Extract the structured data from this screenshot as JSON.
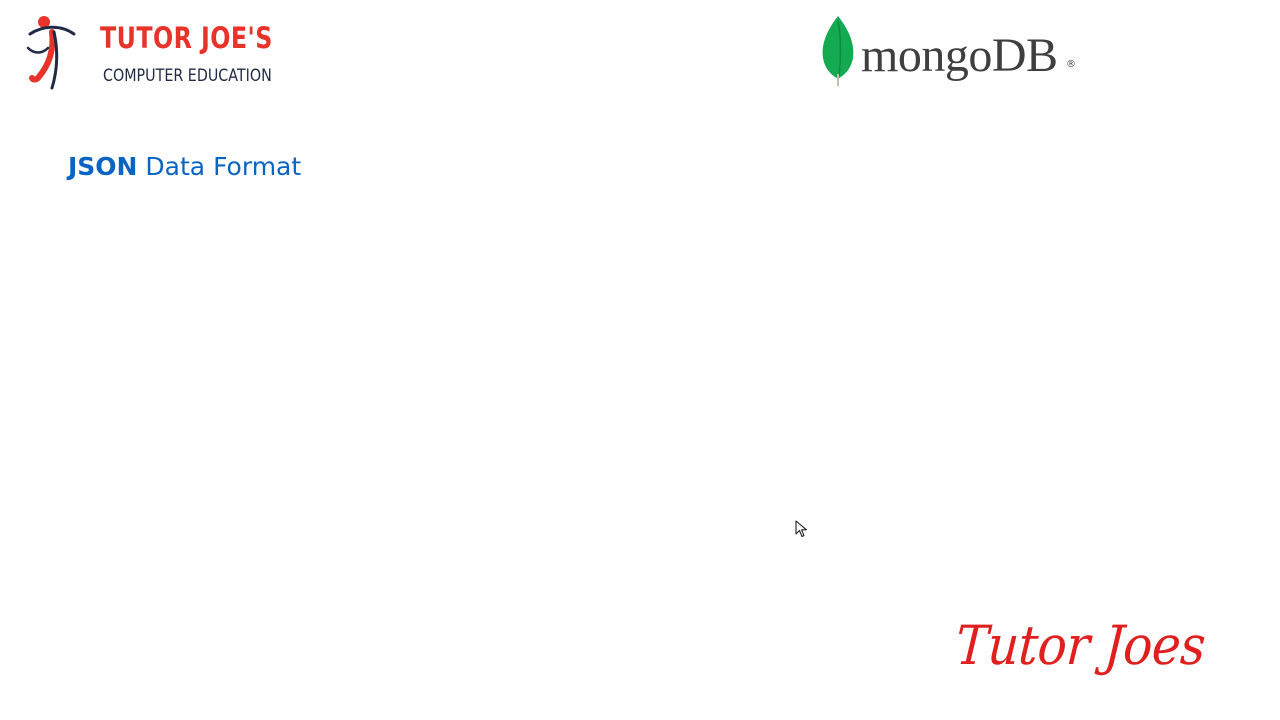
{
  "brand": {
    "title": "TUTOR JOE'S",
    "subtitle": "COMPUTER EDUCATION",
    "mark_icon": "tutor-joes-figure-icon"
  },
  "mongodb_logo": {
    "wordmark": "mongoDB",
    "registered": "®",
    "leaf_icon": "mongodb-leaf-icon"
  },
  "slide": {
    "heading_strong": "JSON",
    "heading_rest": " Data Format"
  },
  "signature": {
    "text": "Tutor Joes"
  },
  "cursor": {
    "icon": "arrow-cursor-icon"
  },
  "colors": {
    "brand_red": "#e8332a",
    "brand_navy": "#1f2a44",
    "heading_blue": "#0a64c3",
    "mongo_green": "#13aa52",
    "mongo_text": "#3f3f3f",
    "signature_red": "#e21f1f"
  }
}
